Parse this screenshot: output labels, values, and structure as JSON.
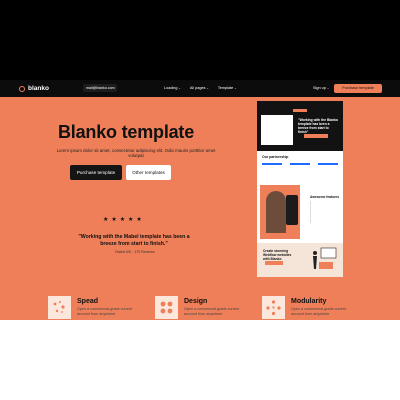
{
  "nav": {
    "logo": "blanko",
    "email_value": "mail@blanko.com",
    "links": [
      "Loading",
      "All pages",
      "Template"
    ],
    "signup": "Sign up",
    "cta": "Purchase template"
  },
  "hero": {
    "title": "Blanko template",
    "description": "Lorem ipsum dolor sit amet, consectetur adipiscing elit. Odio mauris porttitor amet volutpat",
    "primary_button": "Purchase template",
    "secondary_button": "Other templates",
    "stars": "★★★★★",
    "quote": "\"Working with the Mabel template has been a breeze from start to finish.\"",
    "rating": "Rated 5/5 · 175 Reviews"
  },
  "preview": {
    "card_text": "\"Working with the Blanko template has been a breeze from start to finish\"",
    "section_title": "Our partnership",
    "feature_title": "Awesome features",
    "peach_text": "Create stunning Webflow websites with Blanko"
  },
  "features": [
    {
      "title": "Spead",
      "desc": "Open a commercial-grade current account from anywhere",
      "icon": "speed-icon"
    },
    {
      "title": "Design",
      "desc": "Open a commercial-grade current account from anywhere",
      "icon": "design-icon"
    },
    {
      "title": "Modularity",
      "desc": "Open a commercial-grade current account from anywhere",
      "icon": "modularity-icon"
    }
  ],
  "colors": {
    "accent": "#ef7f59",
    "dark": "#0c0c0c",
    "light": "#ffffff"
  }
}
